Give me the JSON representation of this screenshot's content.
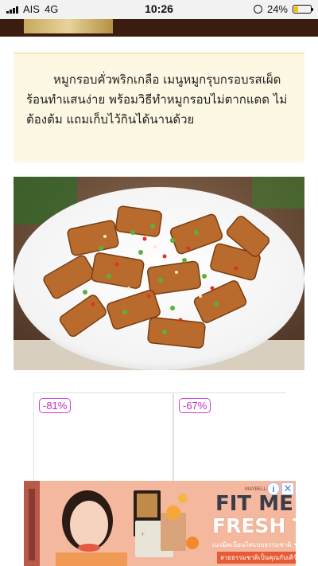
{
  "status_bar": {
    "carrier": "AIS",
    "network": "4G",
    "time": "10:26",
    "battery": "24%",
    "battery_level": 0.24
  },
  "article": {
    "intro_text": "หมูกรอบคั่วพริกเกลือ เมนูหมูกรุบกรอบรสเผ็ดร้อนทำแสนง่าย พร้อมวิธีทำหมูกรอบไม่ตากแดด ไม่ต้องต้ม แถมเก็บไว้กินได้นานด้วย"
  },
  "products": [
    {
      "discount": "-81%"
    },
    {
      "discount": "-67%"
    }
  ],
  "ad": {
    "headline_1": "FIT ME",
    "headline_2": "FRESH TINT",
    "subline": "เนรมิตเนียนใสแบบธรรมชาติ • บางเบาสบายผิว",
    "cta": "สวยธรรมชาติเป็นคุณกับเคิร์ก",
    "brand": "MAYBELLINE",
    "info_icon": "i",
    "close_icon": "✕"
  },
  "colors": {
    "header_band": "#3a1d0f",
    "intro_bg": "#fdf8e3",
    "discount": "#c22ac2",
    "ad_bg": "#f3b89e"
  }
}
